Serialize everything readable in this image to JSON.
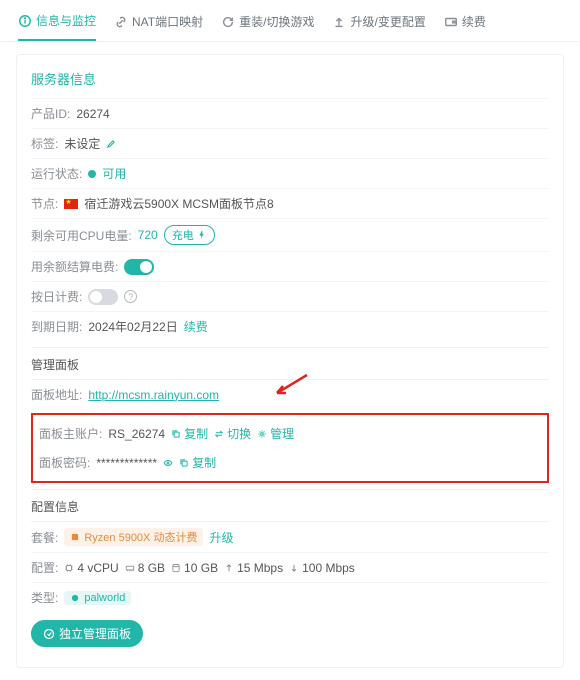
{
  "tabs": {
    "info": "信息与监控",
    "nat": "NAT端口映射",
    "reinstall": "重装/切换游戏",
    "upgrade": "升级/变更配置",
    "renew": "续费"
  },
  "serverInfo": {
    "title": "服务器信息",
    "productIdLabel": "产品ID:",
    "productId": "26274",
    "tagLabel": "标签:",
    "tagValue": "未设定",
    "statusLabel": "运行状态:",
    "statusValue": "可用",
    "nodeLabel": "节点:",
    "nodeValue": "宿迁游戏云5900X MCSM面板节点8",
    "cpuLabel": "剩余可用CPU电量:",
    "cpuValue": "720",
    "chargeBtn": "充电",
    "autoPayLabel": "用余额结算电费:",
    "dailyLabel": "按日计费:",
    "expireLabel": "到期日期:",
    "expireValue": "2024年02月22日",
    "renewLink": "续费"
  },
  "panelSection": {
    "title": "管理面板",
    "urlLabel": "面板地址:",
    "url": "http://mcsm.rainyun.com",
    "acctLabel": "面板主账户:",
    "acctValue": "RS_26274",
    "copy": "复制",
    "switch": "切换",
    "manage": "管理",
    "pwdLabel": "面板密码:",
    "pwdMask": "*************"
  },
  "configSection": {
    "title": "配置信息",
    "planLabel": "套餐:",
    "planChip": "Ryzen 5900X 动态计费",
    "upgradeLink": "升级",
    "configLabel": "配置:",
    "vcpu": "4 vCPU",
    "ram": "8 GB",
    "disk": "10 GB",
    "up": "15 Mbps",
    "down": "100 Mbps",
    "typeLabel": "类型:",
    "typeChip": "palworld",
    "manageBtn": "独立管理面板"
  }
}
